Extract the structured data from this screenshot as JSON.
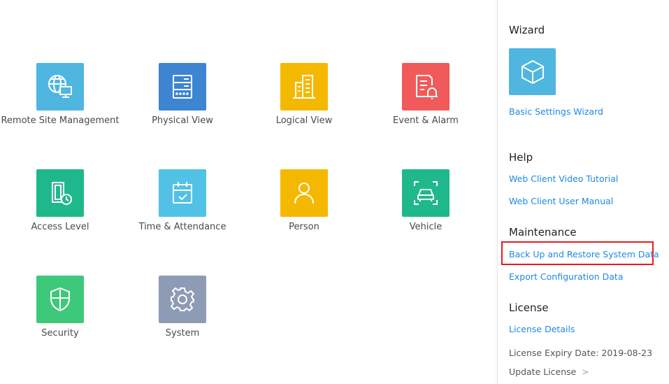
{
  "tiles": [
    {
      "label": "Remote Site Management",
      "icon": "globe-monitor-icon",
      "color": "#4fb6e0"
    },
    {
      "label": "Physical View",
      "icon": "server-icon",
      "color": "#3d84d1"
    },
    {
      "label": "Logical View",
      "icon": "building-icon",
      "color": "#f5b800"
    },
    {
      "label": "Event & Alarm",
      "icon": "document-bell-icon",
      "color": "#f15a5a"
    },
    {
      "label": "Access Level",
      "icon": "door-clock-icon",
      "color": "#1fb88c"
    },
    {
      "label": "Time & Attendance",
      "icon": "calendar-check-icon",
      "color": "#52c1e6"
    },
    {
      "label": "Person",
      "icon": "person-icon",
      "color": "#f5b800"
    },
    {
      "label": "Vehicle",
      "icon": "car-scan-icon",
      "color": "#1fb88c"
    },
    {
      "label": "Security",
      "icon": "shield-icon",
      "color": "#3ec97a"
    },
    {
      "label": "System",
      "icon": "gear-icon",
      "color": "#8e9bb5"
    }
  ],
  "sidebar": {
    "wizard": {
      "title": "Wizard",
      "icon": "cube-icon",
      "link": "Basic Settings Wizard"
    },
    "help": {
      "title": "Help",
      "links": [
        "Web Client Video Tutorial",
        "Web Client User Manual"
      ]
    },
    "maintenance": {
      "title": "Maintenance",
      "links": [
        "Back Up and Restore System Data",
        "Export Configuration Data"
      ]
    },
    "license": {
      "title": "License",
      "details_link": "License Details",
      "expiry": "License Expiry Date: 2019-08-23",
      "update_link": "Update License",
      "update_chevron": ">"
    }
  }
}
